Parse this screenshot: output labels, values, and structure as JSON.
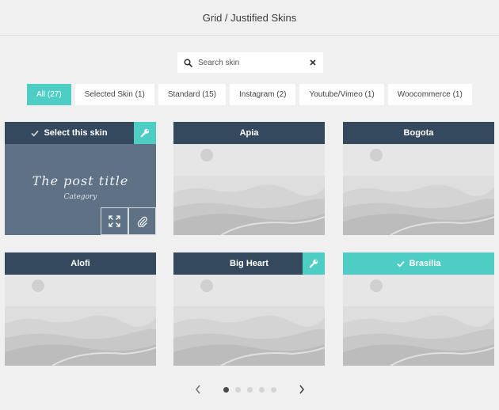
{
  "header": {
    "title": "Grid / Justified Skins"
  },
  "search": {
    "placeholder": "Search skin",
    "value": ""
  },
  "filters": [
    {
      "label": "All (27)",
      "active": true
    },
    {
      "label": "Selected Skin (1)",
      "active": false
    },
    {
      "label": "Standard (15)",
      "active": false
    },
    {
      "label": "Instagram (2)",
      "active": false
    },
    {
      "label": "Youtube/Vimeo (1)",
      "active": false
    },
    {
      "label": "Woocommerce (1)",
      "active": false
    }
  ],
  "cards": [
    {
      "label": "Select this skin",
      "icon": "check-icon",
      "has_wrench": true,
      "preview": true,
      "post_title": "The post title",
      "category": "Category"
    },
    {
      "label": "Apia",
      "has_wrench": false
    },
    {
      "label": "Bogota",
      "has_wrench": false
    },
    {
      "label": "Alofi",
      "has_wrench": false
    },
    {
      "label": "Big Heart",
      "has_wrench": true
    },
    {
      "label": "Brasilia",
      "icon": "check-icon",
      "selected": true,
      "has_wrench": false
    }
  ],
  "pagination": {
    "pages": 5,
    "current": 1
  },
  "colors": {
    "accent": "#4ecdc4",
    "bar": "#34495e",
    "preview_bg": "#5f7184",
    "background": "#f0f0f0"
  }
}
